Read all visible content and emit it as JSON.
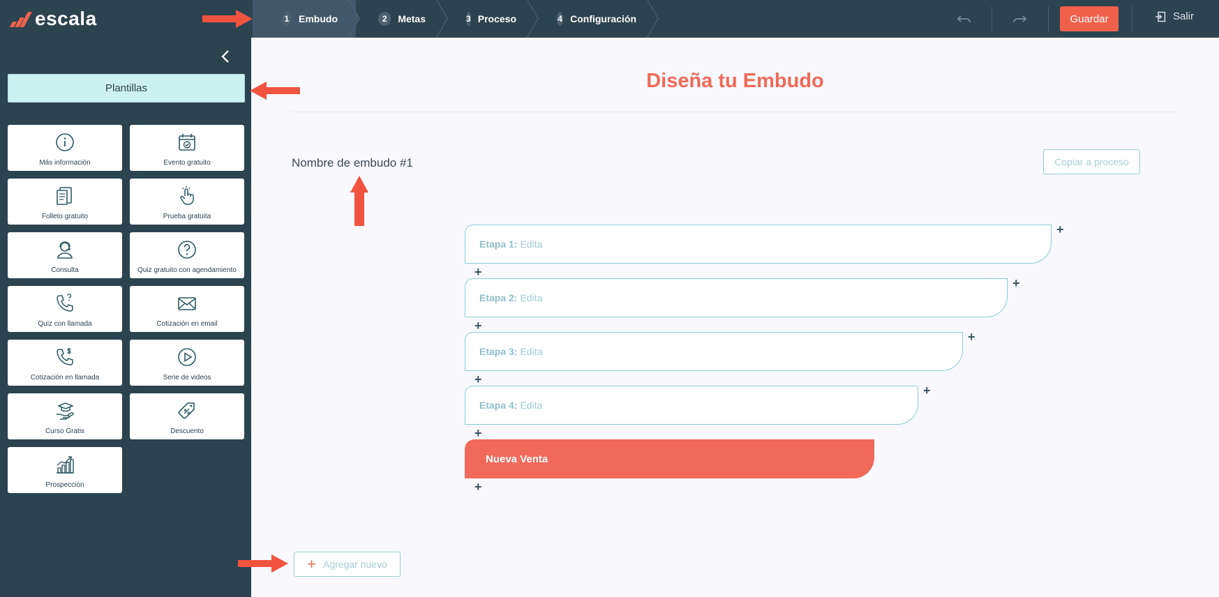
{
  "app": {
    "name": "escala"
  },
  "topbar": {
    "steps": [
      {
        "num": "1",
        "label": "Embudo"
      },
      {
        "num": "2",
        "label": "Metas"
      },
      {
        "num": "3",
        "label": "Proceso"
      },
      {
        "num": "4",
        "label": "Configuración"
      }
    ],
    "save_label": "Guardar",
    "exit_label": "Salir"
  },
  "sidebar": {
    "templates_label": "Plantillas",
    "cards": [
      {
        "label": "Más información",
        "icon": "info-icon"
      },
      {
        "label": "Evento gratuito",
        "icon": "calendar-icon"
      },
      {
        "label": "Folleto gratuito",
        "icon": "brochure-icon"
      },
      {
        "label": "Prueba gratuita",
        "icon": "tap-icon"
      },
      {
        "label": "Consulta",
        "icon": "consultant-icon"
      },
      {
        "label": "Quiz gratuito con agendamiento",
        "icon": "question-icon"
      },
      {
        "label": "Quiz con llamada",
        "icon": "phone-question-icon"
      },
      {
        "label": "Cotización en email",
        "icon": "mail-icon"
      },
      {
        "label": "Cotización en llamada",
        "icon": "phone-dollar-icon"
      },
      {
        "label": "Serie de videos",
        "icon": "play-icon"
      },
      {
        "label": "Curso Gratis",
        "icon": "graduation-icon"
      },
      {
        "label": "Descuento",
        "icon": "discount-tag-icon"
      },
      {
        "label": "Prospección",
        "icon": "growth-chart-icon"
      }
    ]
  },
  "main": {
    "title": "Diseña tu Embudo",
    "funnel_name": "Nombre de embudo #1",
    "copy_label": "Copiar a proceso",
    "stages": [
      {
        "label": "Etapa 1:",
        "value": "Edita"
      },
      {
        "label": "Etapa 2:",
        "value": "Edita"
      },
      {
        "label": "Etapa 3:",
        "value": "Edita"
      },
      {
        "label": "Etapa 4:",
        "value": "Edita"
      }
    ],
    "final_stage": "Nueva Venta",
    "add_new_label": "Agregar nuevo"
  },
  "colors": {
    "sidebar_bg": "#2c4350",
    "accent": "#f0614c",
    "template_button": "#cbf1f1",
    "stage_border": "#8dcbd5",
    "main_bg": "#f8f8fd"
  }
}
